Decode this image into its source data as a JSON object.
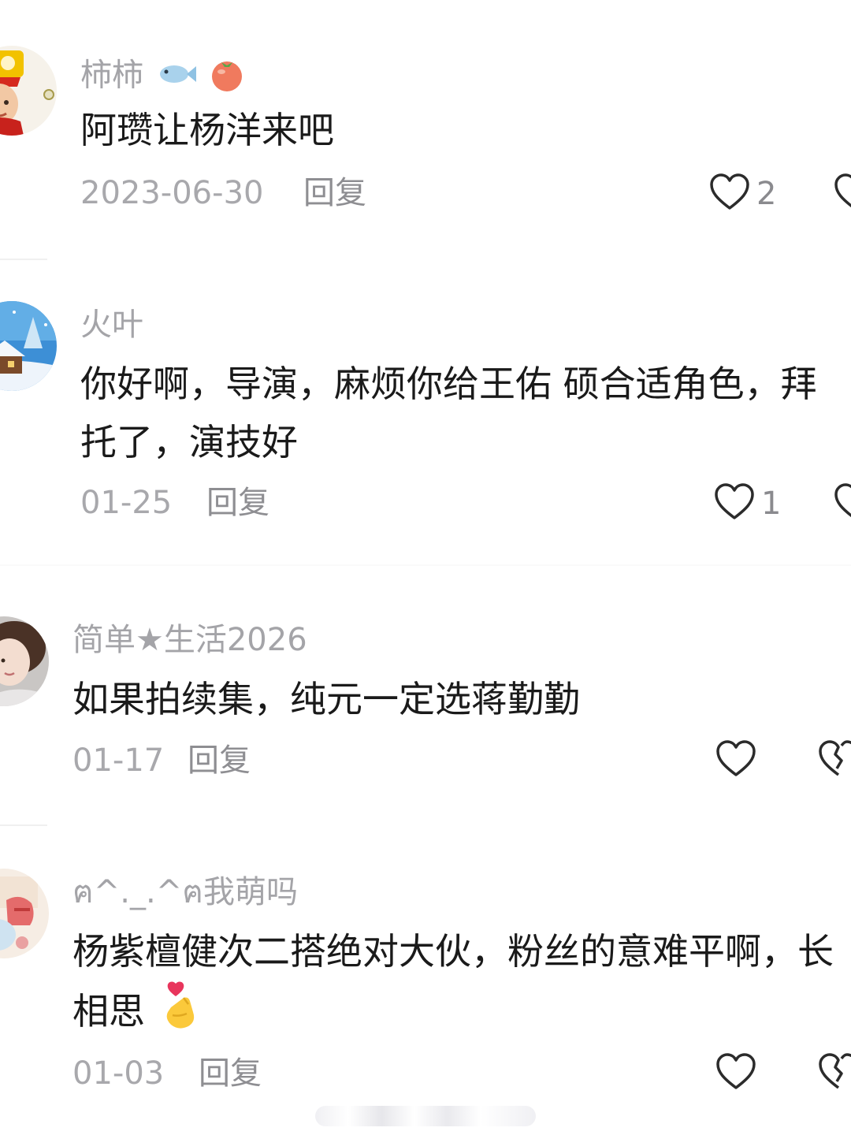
{
  "comments": [
    {
      "username": "柿柿",
      "username_icons": [
        "fish-icon",
        "tomato-icon"
      ],
      "text_lines": [
        "阿瓒让杨洋来吧"
      ],
      "date": "2023-06-30",
      "reply_label": "回复",
      "like_count": "2"
    },
    {
      "username": "火叶",
      "text_lines": [
        "你好啊，导演，麻烦你给王佑 硕合适角色，拜",
        "托了，演技好"
      ],
      "date": "01-25",
      "reply_label": "回复",
      "like_count": "1"
    },
    {
      "username": "简单★生活2026",
      "text_lines": [
        "如果拍续集，纯元一定选蒋勤勤"
      ],
      "date": "01-17",
      "reply_label": "回复",
      "like_count": ""
    },
    {
      "username": "ฅ^._.^ฅ我萌吗",
      "text_lines": [
        "杨紫檀健次二搭绝对大伙，粉丝的意难平啊，长",
        "相思"
      ],
      "text_emoji": "finger-heart-emoji",
      "date": "01-03",
      "reply_label": "回复",
      "like_count": ""
    }
  ],
  "colors": {
    "username": "#a4a4a8",
    "content": "#1a1a1a",
    "meta": "#a8a8ac",
    "icon_stroke": "#2b2b2b"
  }
}
